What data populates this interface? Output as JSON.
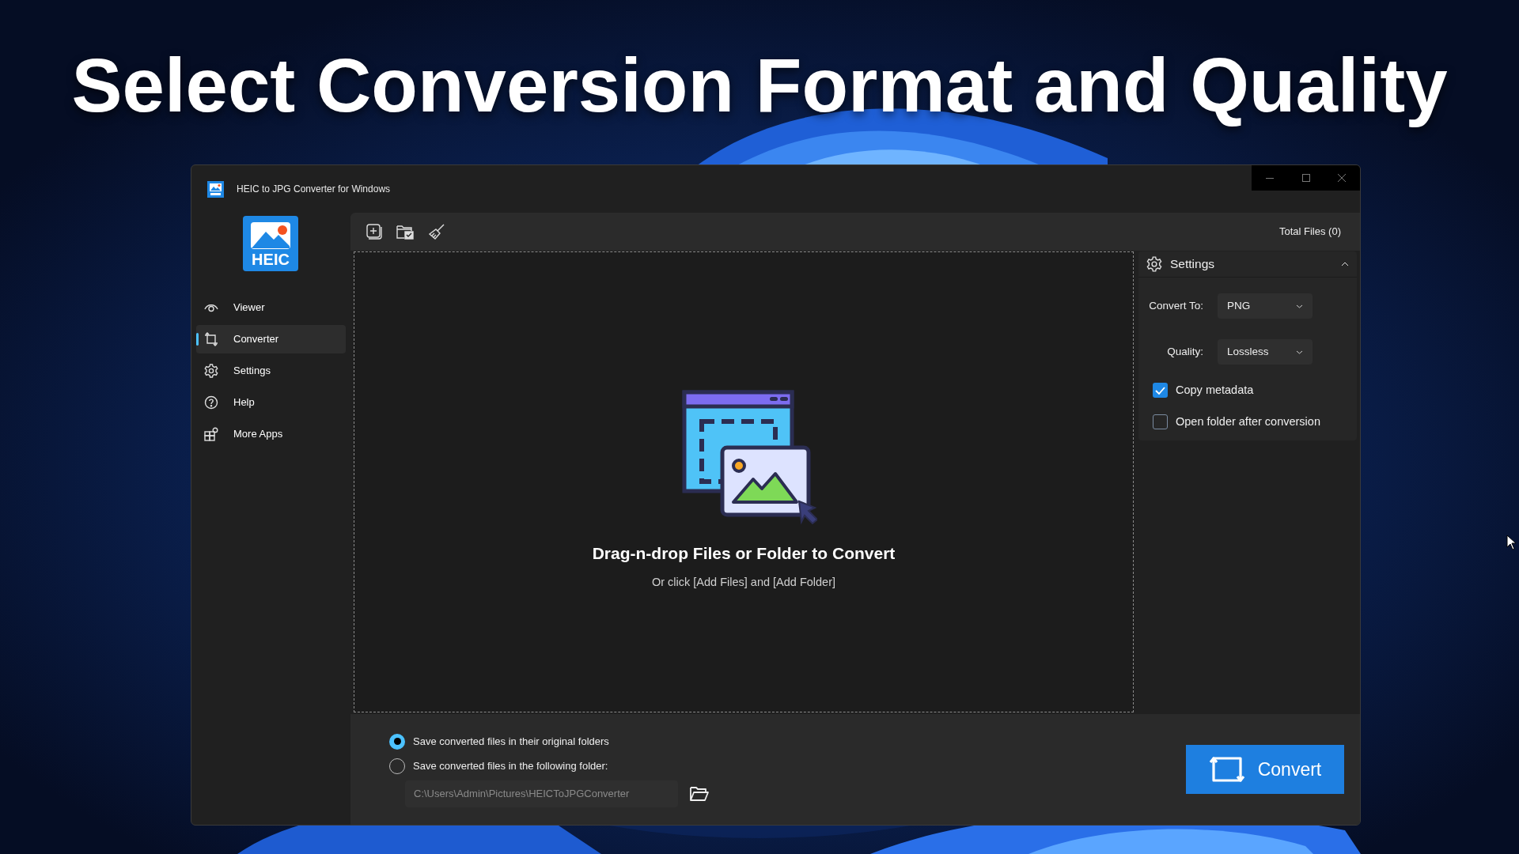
{
  "headline": "Select Conversion Format and Quality",
  "window": {
    "title": "HEIC to JPG Converter for Windows"
  },
  "logo": {
    "text": "HEIC"
  },
  "sidebar": {
    "items": [
      {
        "label": "Viewer",
        "selected": false
      },
      {
        "label": "Converter",
        "selected": true
      },
      {
        "label": "Settings",
        "selected": false
      },
      {
        "label": "Help",
        "selected": false
      },
      {
        "label": "More Apps",
        "selected": false
      }
    ]
  },
  "toolbar": {
    "total_files": "Total Files (0)"
  },
  "drop_zone": {
    "title": "Drag-n-drop Files or Folder to Convert",
    "hint": "Or click [Add Files] and [Add Folder]"
  },
  "settings_panel": {
    "title": "Settings",
    "expanded": true,
    "fields": [
      {
        "label": "Convert To:",
        "value": "PNG"
      },
      {
        "label": "Quality:",
        "value": "Lossless"
      }
    ],
    "options": [
      {
        "label": "Copy metadata",
        "checked": true
      },
      {
        "label": "Open folder after conversion",
        "checked": false
      }
    ]
  },
  "output": {
    "choices": [
      {
        "label": "Save converted files in their original folders",
        "selected": true
      },
      {
        "label": "Save converted files in the following folder:",
        "selected": false
      }
    ],
    "folder_path": "C:\\Users\\Admin\\Pictures\\HEICToJPGConverter"
  },
  "convert_button": "Convert"
}
